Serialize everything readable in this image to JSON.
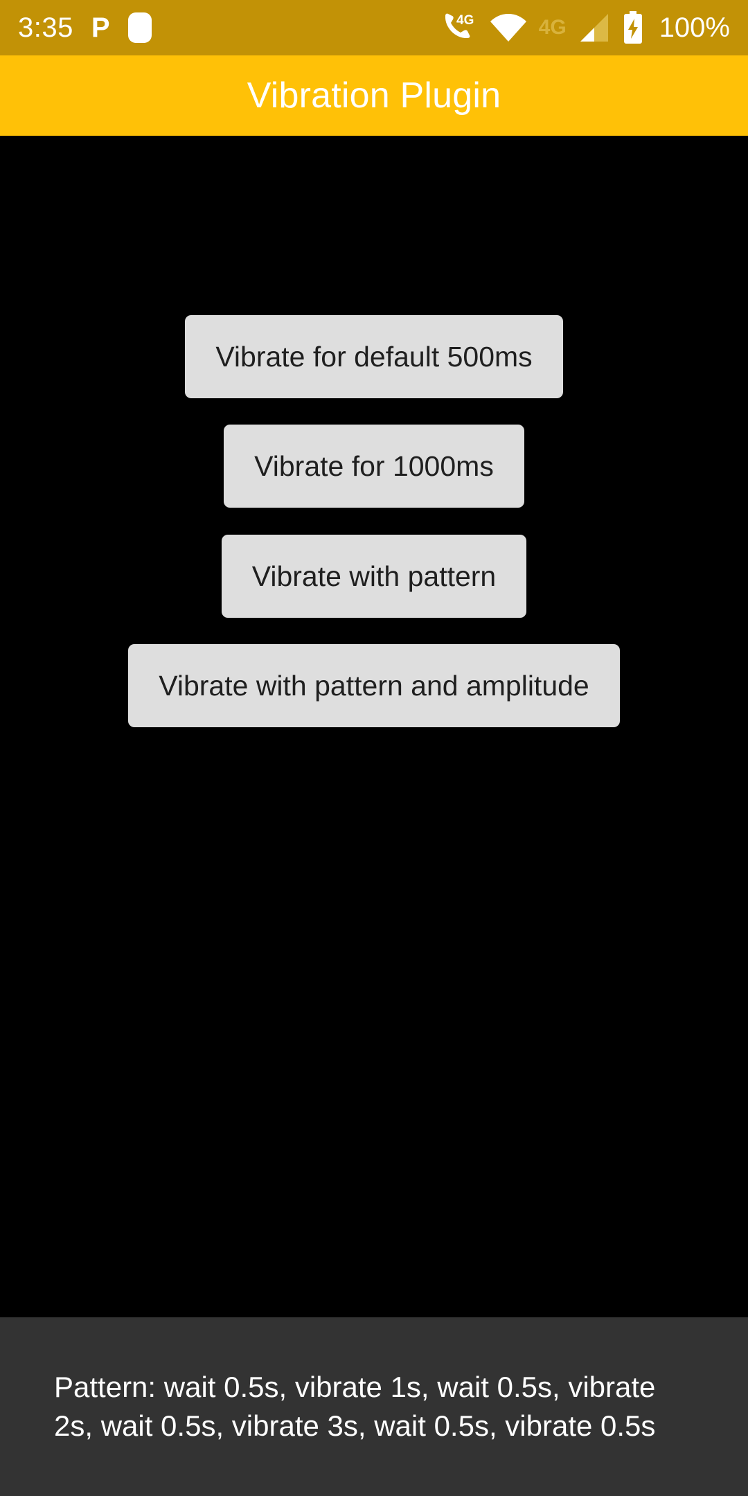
{
  "status_bar": {
    "time": "3:35",
    "icons_left": [
      {
        "name": "pocketcasts-p-icon",
        "glyph": "P"
      },
      {
        "name": "rounded-square-icon",
        "glyph": ""
      }
    ],
    "icons_right": [
      {
        "name": "volte-call-4g-icon",
        "label": "4G"
      },
      {
        "name": "wifi-icon",
        "label": ""
      },
      {
        "name": "mobile-network-4g-label",
        "label": "4G"
      },
      {
        "name": "signal-bars-icon",
        "label": ""
      },
      {
        "name": "battery-charging-icon",
        "label": ""
      }
    ],
    "battery_percent": "100%",
    "background_color": "#C29206",
    "foreground_color": "#FFFFFF"
  },
  "app_bar": {
    "title": "Vibration Plugin",
    "background_color": "#FFC107",
    "title_color": "#FFFFFF"
  },
  "body": {
    "background_color": "#000000",
    "buttons": [
      {
        "id": "vibrate-default-500ms",
        "label": "Vibrate for default 500ms"
      },
      {
        "id": "vibrate-1000ms",
        "label": "Vibrate for 1000ms"
      },
      {
        "id": "vibrate-pattern",
        "label": "Vibrate with pattern"
      },
      {
        "id": "vibrate-pattern-amplitude",
        "label": "Vibrate with pattern and amplitude"
      }
    ],
    "button_background_color": "#DEDEDE",
    "button_text_color": "#1F1F1F"
  },
  "snackbar": {
    "message": "Pattern: wait 0.5s, vibrate 1s, wait 0.5s, vibrate 2s, wait 0.5s, vibrate 3s, wait 0.5s, vibrate 0.5s",
    "background_color": "#333333",
    "text_color": "#FFFFFF"
  }
}
